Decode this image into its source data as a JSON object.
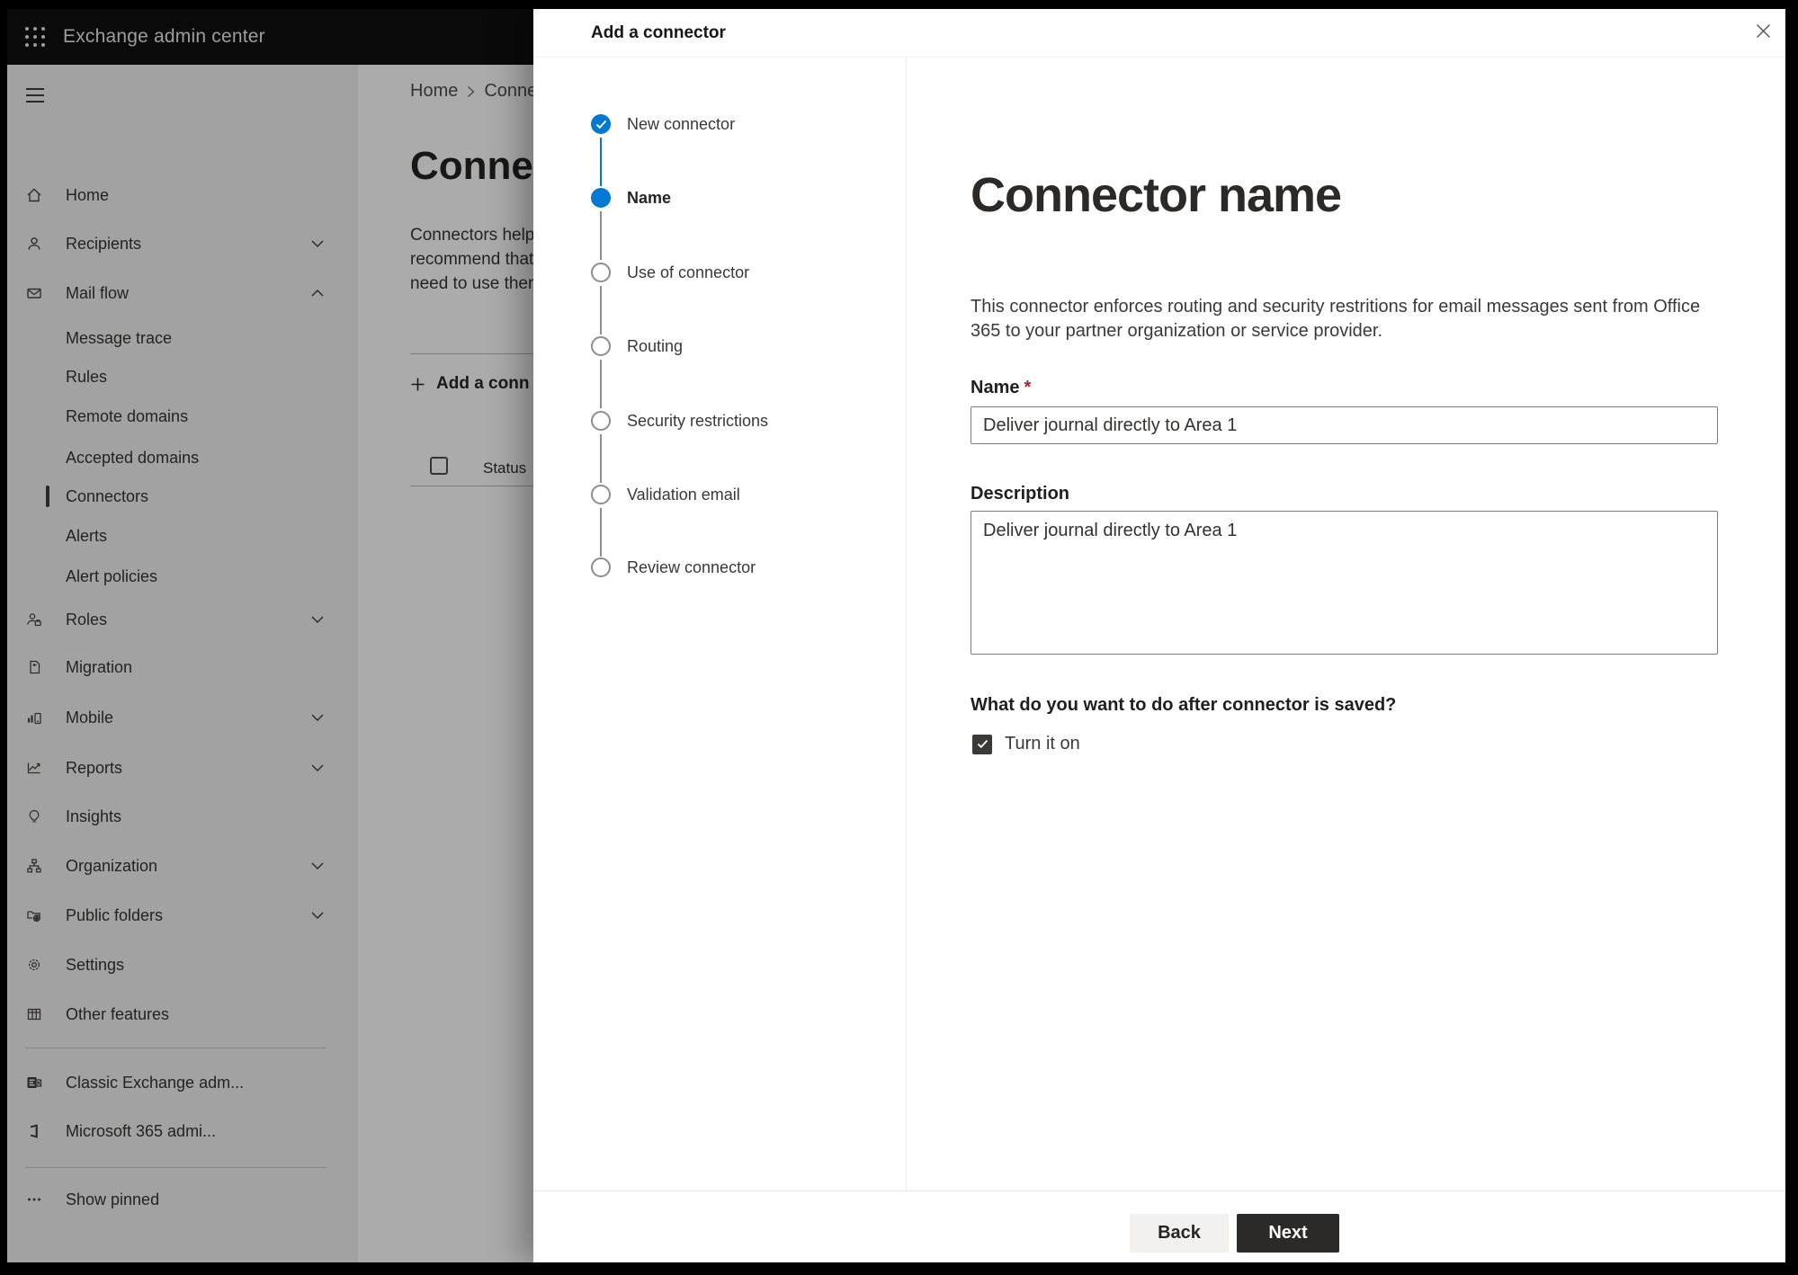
{
  "colors": {
    "accent": "#0078d4",
    "topbar": "#0b0b0b",
    "next_button": "#2b2a28",
    "back_button": "#f2f1f0",
    "checkbox_checked": "#3b3a39",
    "required_marker_color": "#a4262c",
    "step_upcoming_border": "#8f8e8c"
  },
  "app": {
    "title": "Exchange admin center"
  },
  "breadcrumb": {
    "home": "Home",
    "current": "Conne"
  },
  "background_page": {
    "title": "Connec",
    "body_lines": [
      "Connectors help",
      "recommend that",
      "need to use ther"
    ],
    "add_button_label": "Add a conn",
    "status_header": "Status"
  },
  "sidebar": {
    "items": [
      {
        "label": "Home"
      },
      {
        "label": "Recipients",
        "has_submenu": true
      },
      {
        "label": "Mail flow",
        "has_submenu": true,
        "expanded": true
      },
      {
        "label": "Message trace"
      },
      {
        "label": "Rules"
      },
      {
        "label": "Remote domains"
      },
      {
        "label": "Accepted domains"
      },
      {
        "label": "Connectors",
        "selected": true
      },
      {
        "label": "Alerts"
      },
      {
        "label": "Alert policies"
      },
      {
        "label": "Roles",
        "has_submenu": true
      },
      {
        "label": "Migration"
      },
      {
        "label": "Mobile",
        "has_submenu": true
      },
      {
        "label": "Reports",
        "has_submenu": true
      },
      {
        "label": "Insights"
      },
      {
        "label": "Organization",
        "has_submenu": true
      },
      {
        "label": "Public folders",
        "has_submenu": true
      },
      {
        "label": "Settings"
      },
      {
        "label": "Other features"
      },
      {
        "label": "Classic Exchange adm..."
      },
      {
        "label": "Microsoft 365 admi..."
      },
      {
        "label": "Show pinned"
      }
    ]
  },
  "dialog": {
    "title": "Add a connector",
    "steps": [
      {
        "label": "New connector",
        "state": "completed"
      },
      {
        "label": "Name",
        "state": "current"
      },
      {
        "label": "Use of connector",
        "state": "upcoming"
      },
      {
        "label": "Routing",
        "state": "upcoming"
      },
      {
        "label": "Security restrictions",
        "state": "upcoming"
      },
      {
        "label": "Validation email",
        "state": "upcoming"
      },
      {
        "label": "Review connector",
        "state": "upcoming"
      }
    ],
    "content": {
      "heading": "Connector name",
      "description": "This connector enforces routing and security restritions for email messages sent from Office 365 to your partner organization or service provider.",
      "name_label": "Name",
      "required_marker": "*",
      "name_value": "Deliver journal directly to Area 1",
      "description_label": "Description",
      "description_value": "Deliver journal directly to Area 1",
      "after_save_question": "What do you want to do after connector is saved?",
      "turn_on_label": "Turn it on",
      "turn_on_checked": true
    },
    "footer": {
      "back_label": "Back",
      "next_label": "Next"
    }
  }
}
